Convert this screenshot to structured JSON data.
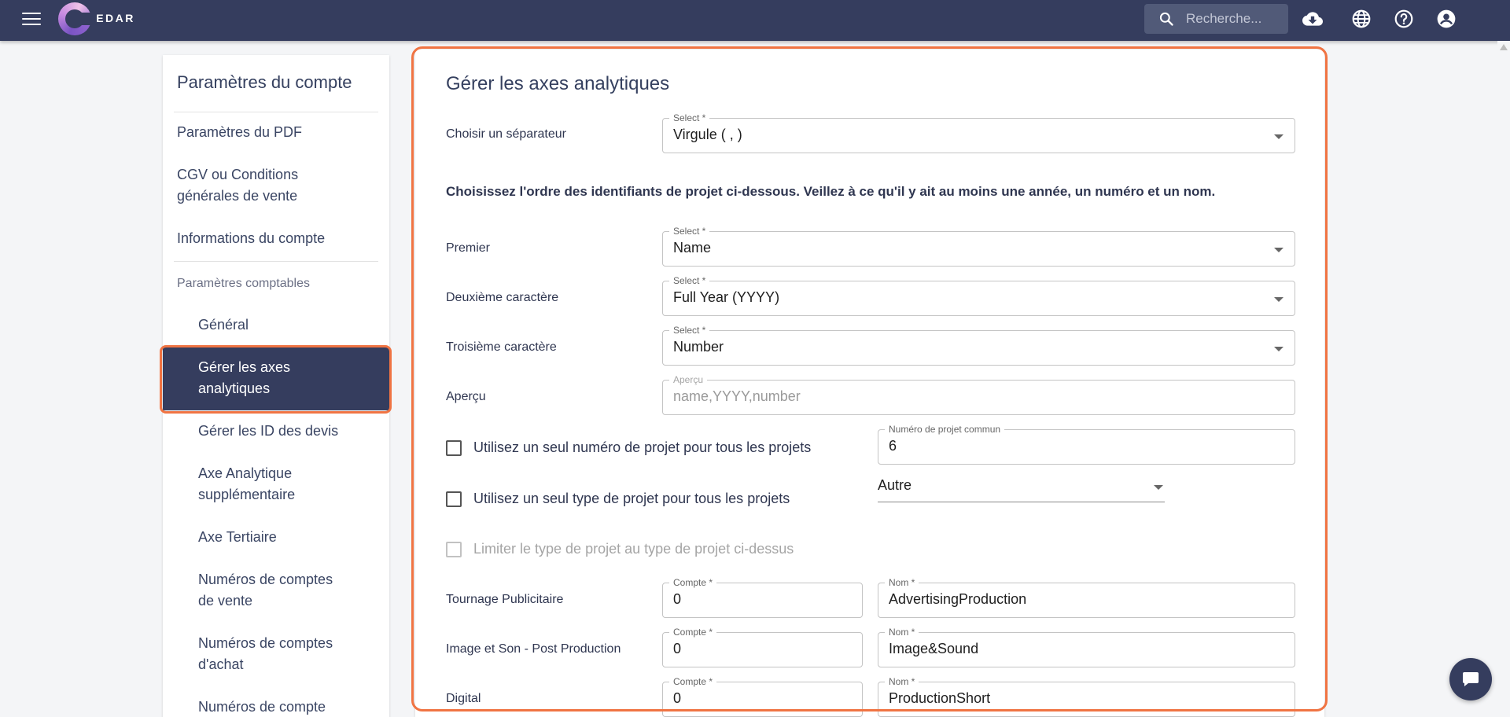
{
  "app": {
    "logo_text": "CHEDAR"
  },
  "topbar": {
    "search_placeholder": "Recherche...",
    "icons": [
      "menu-icon",
      "cloud-download-icon",
      "globe-icon",
      "help-icon",
      "account-icon"
    ]
  },
  "nav": {
    "title": "Paramètres du compte",
    "items": [
      {
        "lines": [
          "Paramètres du PDF"
        ]
      },
      {
        "lines": [
          "CGV ou Conditions",
          "générales de vente"
        ]
      },
      {
        "lines": [
          "Informations du compte"
        ]
      }
    ],
    "section_label": "Paramètres comptables",
    "sub_items": [
      {
        "lines": [
          "Général"
        ]
      },
      {
        "lines": [
          "Gérer les axes",
          "analytiques"
        ],
        "active": true
      },
      {
        "lines": [
          "Gérer les ID des devis"
        ]
      },
      {
        "lines": [
          "Axe Analytique",
          "supplémentaire"
        ]
      },
      {
        "lines": [
          "Axe Tertiaire"
        ]
      },
      {
        "lines": [
          "Numéros de comptes",
          "de vente"
        ]
      },
      {
        "lines": [
          "Numéros de comptes",
          "d'achat"
        ]
      },
      {
        "lines": [
          "Numéros de compte"
        ]
      }
    ]
  },
  "main": {
    "title": "Gérer les axes analytiques",
    "separator": {
      "label": "Choisir un séparateur",
      "legend": "Select *",
      "value": "Virgule ( , )"
    },
    "instruction": "Choisissez l'ordre des identifiants de projet ci-dessous. Veillez à ce qu'il y ait au moins une année, un numéro et un nom.",
    "order": [
      {
        "label": "Premier",
        "legend": "Select *",
        "value": "Name"
      },
      {
        "label": "Deuxième caractère",
        "legend": "Select *",
        "value": "Full Year (YYYY)"
      },
      {
        "label": "Troisième caractère",
        "legend": "Select *",
        "value": "Number"
      }
    ],
    "preview": {
      "label": "Aperçu",
      "legend": "Aperçu",
      "value": "name,YYYY,number"
    },
    "single_number": {
      "label": "Utilisez un seul numéro de projet pour tous les projets",
      "legend": "Numéro de projet commun",
      "value": "6",
      "checked": false
    },
    "single_type": {
      "label": "Utilisez un seul type de projet pour tous les projets",
      "value": "Autre",
      "checked": false
    },
    "limit_type": {
      "label": "Limiter le type de projet au type de projet ci-dessus",
      "disabled": true
    },
    "project_types": [
      {
        "label": "Tournage Publicitaire",
        "compte_legend": "Compte *",
        "compte": "0",
        "nom_legend": "Nom *",
        "nom": "AdvertisingProduction"
      },
      {
        "label": "Image et Son - Post Production",
        "compte_legend": "Compte *",
        "compte": "0",
        "nom_legend": "Nom *",
        "nom": "Image&Sound"
      },
      {
        "label": "Digital",
        "compte_legend": "Compte *",
        "compte": "0",
        "nom_legend": "Nom *",
        "nom": "ProductionShort"
      }
    ]
  },
  "colors": {
    "topbar": "#353d5e",
    "accent_outline": "#f07443",
    "nav_active": "#353d5e"
  }
}
